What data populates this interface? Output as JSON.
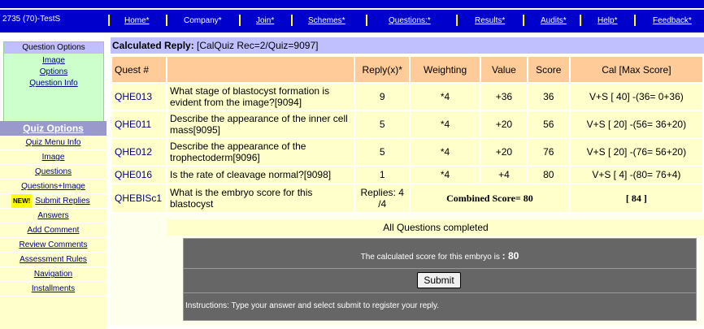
{
  "app": {
    "id_label": "2735 (70)-TestS"
  },
  "nav": [
    {
      "label": "Home*",
      "linked": true
    },
    {
      "label": "Company*",
      "linked": false
    },
    {
      "label": "Join*",
      "linked": true
    },
    {
      "label": "Schemes*",
      "linked": true
    },
    {
      "label": "Questions:*",
      "linked": true
    },
    {
      "label": "Results*",
      "linked": true
    },
    {
      "label": "Audits*",
      "linked": true
    },
    {
      "label": "Help*",
      "linked": true
    },
    {
      "label": "Feedback*",
      "linked": true
    }
  ],
  "question_options": {
    "title": "Question Options",
    "links": [
      "Image",
      "Options",
      "Question Info"
    ]
  },
  "quiz_options": {
    "title": "Quiz Options",
    "items": [
      "Quiz Menu Info",
      "Image",
      "Questions",
      "Questions+Image",
      "Submit Replies",
      "Answers",
      "Add Comment",
      "Review Comments",
      "Assessment Rules",
      "Navigation",
      "Installments"
    ],
    "new_badge": "NEW!"
  },
  "main": {
    "title_bold": "Calculated Reply:",
    "title_rest": " [CalQuiz Rec=2/Quiz=9097]",
    "headers": [
      "Quest #",
      "",
      "Reply(x)*",
      "Weighting",
      "Value",
      "Score",
      "Cal [Max Score]"
    ],
    "rows": [
      {
        "id": "QHE013",
        "question": "What stage of blastocyst formation is evident from the image?[9094]",
        "reply": "9",
        "weighting": "*4",
        "value": "+36",
        "score": "36",
        "cal": "V+S [ 40] -(36= 0+36)"
      },
      {
        "id": "QHE011",
        "question": "Describe the appearance of the inner cell mass[9095]",
        "reply": "5",
        "weighting": "*4",
        "value": "+20",
        "score": "56",
        "cal": "V+S [ 20] -(56= 36+20)"
      },
      {
        "id": "QHE012",
        "question": "Describe the appearance of the trophectoderm[9096]",
        "reply": "5",
        "weighting": "*4",
        "value": "+20",
        "score": "76",
        "cal": "V+S [ 20] -(76= 56+20)"
      },
      {
        "id": "QHE016",
        "question": "Is the rate of cleavage normal?[9098]",
        "reply": "1",
        "weighting": "*4",
        "value": "+4",
        "score": "80",
        "cal": "V+S [ 4] -(80= 76+4)"
      }
    ],
    "summary": {
      "id": "QHEBISc1",
      "question": "What is the embryo score for this blastocyst",
      "replies": "Replies: 4 /4",
      "combined": "Combined Score= 80",
      "max": "[ 84 ]"
    },
    "all_completed": "All Questions completed",
    "panel": {
      "score_text": "The calculated score for this embryo is",
      "score_value": ": 80",
      "submit_label": "Submit",
      "instructions": "Instructions: Type your answer and select submit to register your reply."
    }
  }
}
